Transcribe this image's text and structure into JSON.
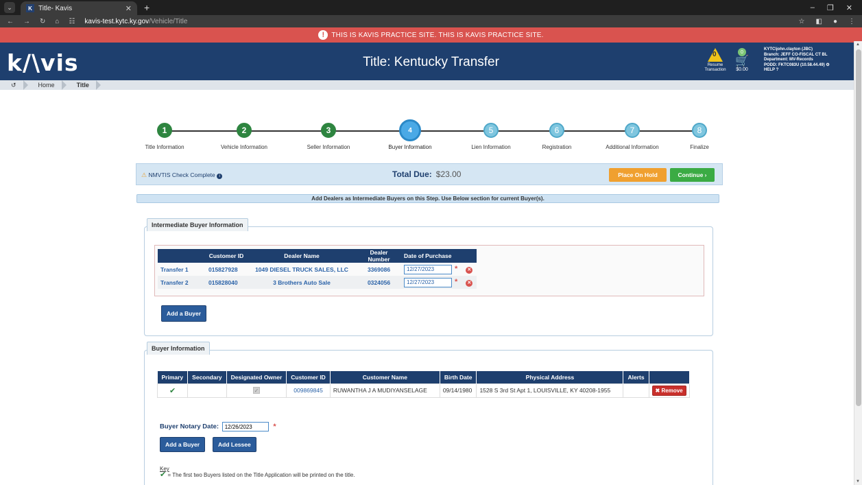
{
  "browser": {
    "tab_title": "Title- Kavis",
    "url_host": "kavis-test.kytc.ky.gov",
    "url_path": "/Vehicle/Title"
  },
  "banner": {
    "text": "THIS IS KAVIS PRACTICE SITE. THIS IS KAVIS PRACTICE SITE."
  },
  "header": {
    "logo": "k/\\vis",
    "title": "Title: Kentucky Transfer",
    "resume_count": "0",
    "resume_label_1": "Resume",
    "resume_label_2": "Transaction",
    "cart_count": "0",
    "cart_total": "$0.00",
    "user_line": "KYTC\\john.clayton (JBC)",
    "branch_line": "Branch: JEFF CO-FISCAL CT BL",
    "department_line": "Department: MV-Records",
    "podd_line": "PODD: FKTC083U (10.58.44.49)",
    "help_label": "HELP"
  },
  "breadcrumb": {
    "home": "Home",
    "current": "Title"
  },
  "steps": [
    {
      "num": "1",
      "label": "Title Information",
      "state": "done"
    },
    {
      "num": "2",
      "label": "Vehicle Information",
      "state": "done"
    },
    {
      "num": "3",
      "label": "Seller Information",
      "state": "done"
    },
    {
      "num": "4",
      "label": "Buyer Information",
      "state": "active"
    },
    {
      "num": "5",
      "label": "Lien Information",
      "state": "todo"
    },
    {
      "num": "6",
      "label": "Registration",
      "state": "todo"
    },
    {
      "num": "7",
      "label": "Additional Information",
      "state": "todo"
    },
    {
      "num": "8",
      "label": "Finalize",
      "state": "todo"
    }
  ],
  "infobar": {
    "nmvtis": "NMVTIS Check Complete",
    "total_label": "Total Due:",
    "total_amount": "$23.00",
    "hold_button": "Place On Hold",
    "continue_button": "Continue"
  },
  "notice": "Add Dealers as Intermediate Buyers on this Step. Use Below section for current Buyer(s).",
  "intermediate": {
    "legend": "Intermediate Buyer Information",
    "headers": [
      "Customer ID",
      "Dealer Name",
      "Dealer Number",
      "Date of Purchase"
    ],
    "rows": [
      {
        "transfer": "Transfer 1",
        "customer_id": "015827928",
        "dealer_name": "1049 DIESEL TRUCK SALES, LLC",
        "dealer_number": "3369086",
        "date": "12/27/2023"
      },
      {
        "transfer": "Transfer 2",
        "customer_id": "015828040",
        "dealer_name": "3 Brothers Auto Sale",
        "dealer_number": "0324056",
        "date": "12/27/2023"
      }
    ],
    "add_buyer": "Add a Buyer"
  },
  "buyer": {
    "legend": "Buyer Information",
    "headers": [
      "Primary",
      "Secondary",
      "Designated Owner",
      "Customer ID",
      "Customer Name",
      "Birth Date",
      "Physical Address",
      "Alerts",
      ""
    ],
    "row": {
      "customer_id": "009869845",
      "customer_name": "RUWANTHA J A MUDIYANSELAGE",
      "birth_date": "09/14/1980",
      "address": "1528 S 3rd St Apt 1, LOUISVILLE, KY 40208-1955",
      "remove": "Remove"
    },
    "notary_label": "Buyer Notary Date:",
    "notary_value": "12/26/2023",
    "add_buyer": "Add a Buyer",
    "add_lessee": "Add Lessee",
    "key_title": "Key",
    "key_text": "= The first two Buyers listed on the Title Application will be printed on the title."
  },
  "colors": {
    "navy": "#1e3f6e",
    "banner_red": "#d9534f",
    "step_done": "#2e8540",
    "step_active": "#4aa9e6",
    "hold_orange": "#f0a030",
    "continue_green": "#3bab44"
  }
}
